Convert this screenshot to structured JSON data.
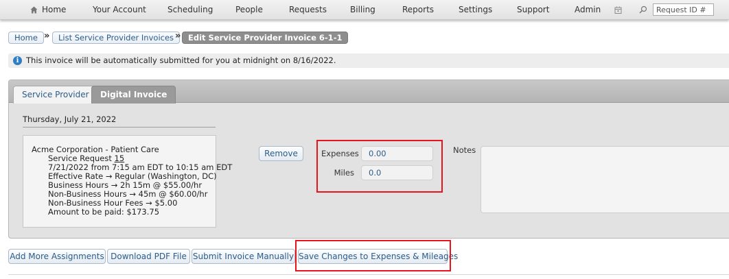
{
  "nav": {
    "home": "Home",
    "items": [
      "Your Account",
      "Scheduling",
      "People",
      "Requests",
      "Billing",
      "Reports",
      "Settings",
      "Support",
      "Admin"
    ],
    "request_id_placeholder": "Request ID #"
  },
  "breadcrumbs": [
    "Home",
    "List Service Provider Invoices",
    "Edit Service Provider Invoice 6-1-1"
  ],
  "breadcrumb_separator": "»",
  "info_message": "This invoice will be automatically submitted for you at midnight on 8/16/2022.",
  "tabs": {
    "service_provider": "Service Provider",
    "digital_invoice": "Digital Invoice"
  },
  "invoice": {
    "date": "Thursday, July 21, 2022",
    "assignment": {
      "client": "Acme Corporation - Patient Care",
      "service_request_label": "Service Request",
      "service_request_number": "15",
      "time": "7/21/2022 from 7:15 am EDT to 10:15 am EDT",
      "effective_rate": "Effective Rate → Regular (Washington, DC)",
      "business_hours": "Business Hours → 2h 15m @ $55.00/hr",
      "non_business_hours": "Non-Business Hours → 45m @ $60.00/hr",
      "non_business_fees": "Non-Business Hour Fees → $5.00",
      "amount": "Amount to be paid: $173.75"
    },
    "remove_label": "Remove",
    "expenses_label": "Expenses",
    "expenses_value": "0.00",
    "miles_label": "Miles",
    "miles_value": "0.0",
    "notes_label": "Notes",
    "notes_value": ""
  },
  "actions": {
    "add_more": "Add More Assignments",
    "download_pdf": "Download PDF File",
    "submit_manually": "Submit Invoice Manually",
    "save_changes": "Save Changes to Expenses & Mileages"
  },
  "colors": {
    "highlight": "#e8141c",
    "link_blue": "#2d5c88",
    "info_blue": "#2d7ec3"
  }
}
